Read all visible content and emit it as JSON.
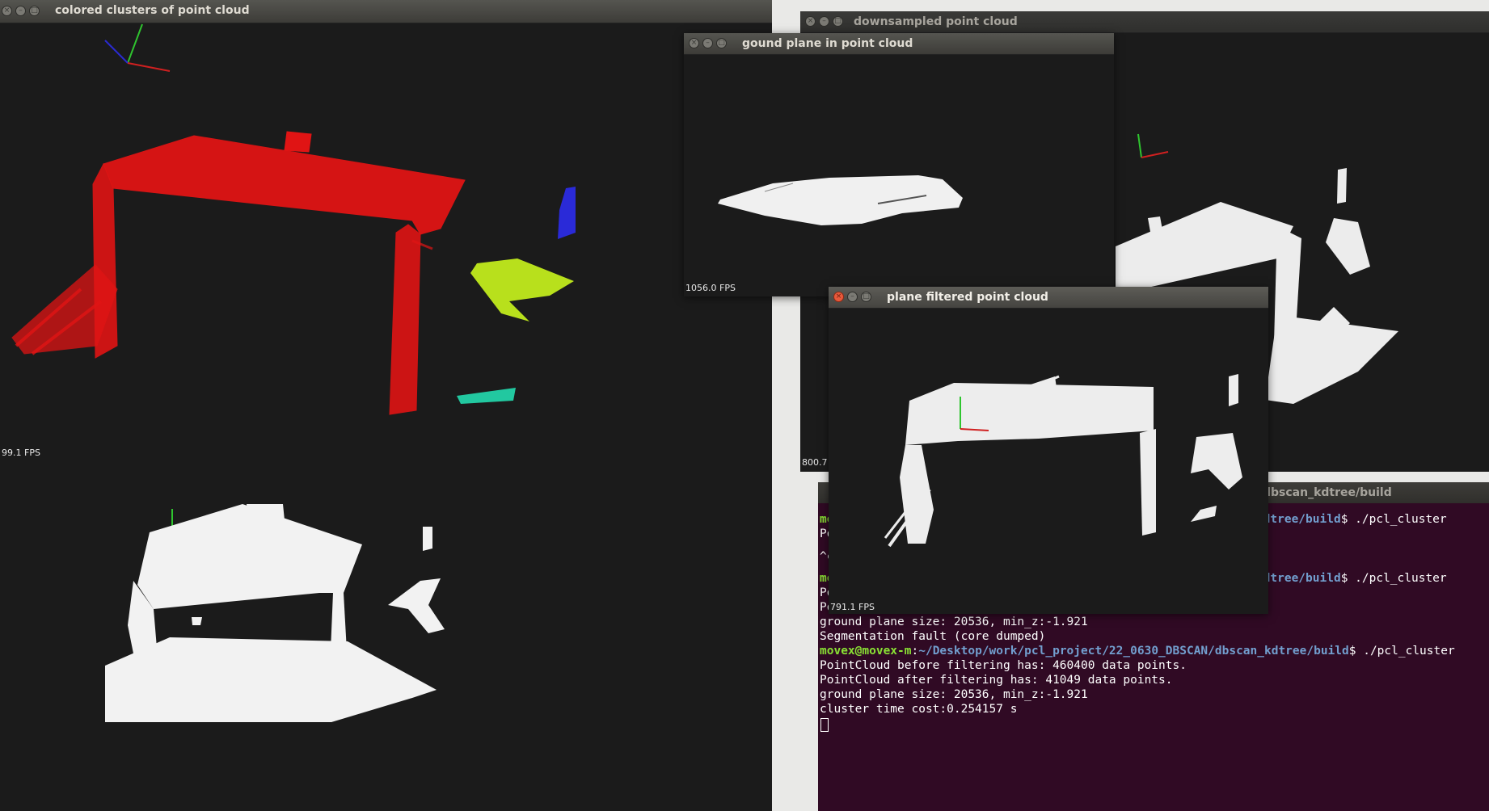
{
  "windows": {
    "clusters": {
      "title": "colored clusters of point cloud",
      "fps": "99.1 FPS"
    },
    "downsampled": {
      "title": "downsampled point cloud",
      "fps": "800.7"
    },
    "ground_plane": {
      "title": "gound plane in point cloud",
      "fps": "1056.0 FPS"
    },
    "plane_filtered": {
      "title": "plane filtered point cloud",
      "fps": "791.1 FPS"
    }
  },
  "terminal": {
    "title_fragment": "dbscan_kdtree/build",
    "lines": [
      {
        "prompt_user": "mo",
        "prompt_path": "n_kdtree/build",
        "suffix": "$ ./pcl_cluster"
      },
      {
        "text": "Po"
      },
      {
        "text": "^c"
      },
      {
        "prompt_user": "mo",
        "prompt_path": "n_kdtree/build",
        "suffix": "$ ./pcl_cluster"
      },
      {
        "text": "Po"
      },
      {
        "text": "Po"
      },
      {
        "text": "ground plane size: 20536, min_z:-1.921"
      },
      {
        "text": "Segmentation fault (core dumped)"
      },
      {
        "prompt_user": "movex@movex-m",
        "prompt_path": "~/Desktop/work/pcl_project/22_0630_DBSCAN/dbscan_kdtree/build",
        "suffix": "$ ./pcl_cluster"
      },
      {
        "text": "PointCloud before filtering has: 460400 data points."
      },
      {
        "text": "PointCloud after filtering has: 41049 data points."
      },
      {
        "text": "ground plane size: 20536, min_z:-1.921"
      },
      {
        "text": "cluster time cost:0.254157 s"
      }
    ]
  },
  "colors": {
    "viewer_bg": "#1b1b1b",
    "terminal_bg": "#300a24",
    "cluster_red": "#e01414",
    "cluster_blue": "#2a2ad8",
    "cluster_yellow": "#b8e01c",
    "cluster_teal": "#22c8a0",
    "points_white": "#f2f2f2"
  },
  "icons": [
    "close-icon",
    "minimize-icon",
    "maximize-icon",
    "axes-icon"
  ]
}
